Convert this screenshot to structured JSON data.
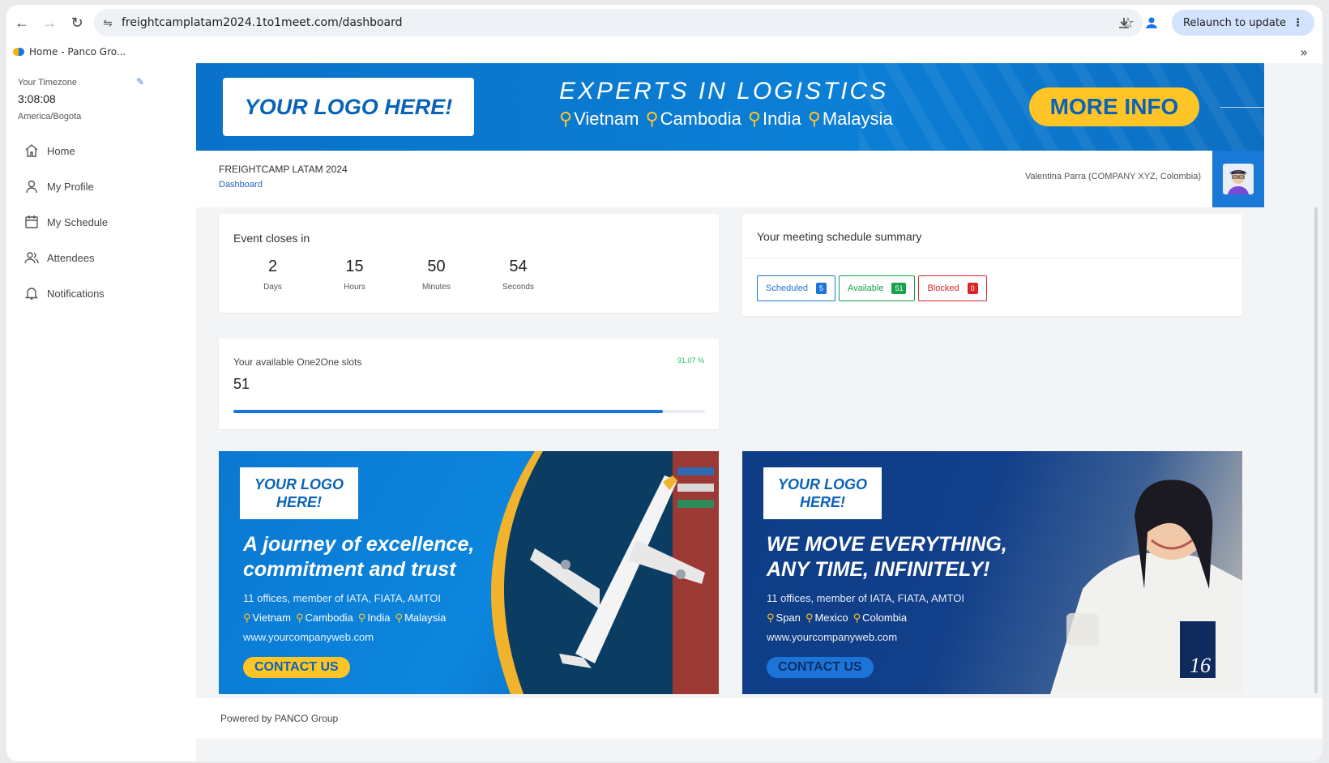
{
  "browser": {
    "url": "freightcamplatam2024.1to1meet.com/dashboard",
    "relaunch_label": "Relaunch to update",
    "bookmark_label": "Home - Panco Gro...",
    "more_glyph": "»"
  },
  "sidebar": {
    "timezone_label": "Your Timezone",
    "time": "3:08:08",
    "zone": "America/Bogota",
    "items": [
      {
        "label": "Home",
        "icon": "home-icon"
      },
      {
        "label": "My Profile",
        "icon": "user-icon"
      },
      {
        "label": "My Schedule",
        "icon": "calendar-icon"
      },
      {
        "label": "Attendees",
        "icon": "users-icon"
      },
      {
        "label": "Notifications",
        "icon": "bell-icon"
      }
    ]
  },
  "banner": {
    "logo_text": "YOUR LOGO HERE!",
    "title": "EXPERTS IN LOGISTICS",
    "countries": [
      "Vietnam",
      "Cambodia",
      "India",
      "Malaysia"
    ],
    "cta": "MORE INFO"
  },
  "header": {
    "event_name": "FREIGHTCAMP LATAM 2024",
    "breadcrumb": "Dashboard",
    "user": "Valentina Parra (COMPANY XYZ, Colombia)"
  },
  "countdown": {
    "title": "Event closes in",
    "units": [
      {
        "value": "2",
        "label": "Days"
      },
      {
        "value": "15",
        "label": "Hours"
      },
      {
        "value": "50",
        "label": "Minutes"
      },
      {
        "value": "54",
        "label": "Seconds"
      }
    ]
  },
  "schedule": {
    "title": "Your meeting schedule summary",
    "pills": [
      {
        "label": "Scheduled",
        "count": "5",
        "color": "#1d74d8"
      },
      {
        "label": "Available",
        "count": "51",
        "color": "#16a34a"
      },
      {
        "label": "Blocked",
        "count": "0",
        "color": "#dc2626"
      }
    ]
  },
  "slots": {
    "title": "Your available One2One slots",
    "value": "51",
    "percent": "91.07 %",
    "fraction": 0.9107
  },
  "ads": [
    {
      "logo": "YOUR LOGO HERE!",
      "headline_1": "A journey of excellence,",
      "headline_2": "commitment and trust",
      "sub": "11 offices, member of IATA, FIATA, AMTOI",
      "countries": [
        "Vietnam",
        "Cambodia",
        "India",
        "Malaysia"
      ],
      "web": "www.yourcompanyweb.com",
      "cta": "CONTACT US"
    },
    {
      "logo": "YOUR LOGO HERE!",
      "headline_1": "WE MOVE EVERYTHING,",
      "headline_2": "ANY TIME, INFINITELY!",
      "sub": "11 offices, member of IATA, FIATA, AMTOI",
      "countries": [
        "Span",
        "Mexico",
        "Colombia"
      ],
      "web": "www.yourcompanyweb.com",
      "cta": "CONTACT US",
      "table_number": "16"
    }
  ],
  "footer": {
    "text": "Powered by PANCO Group"
  },
  "colors": {
    "brand_blue": "#0a72c9",
    "accent_yellow": "#ffc526"
  }
}
